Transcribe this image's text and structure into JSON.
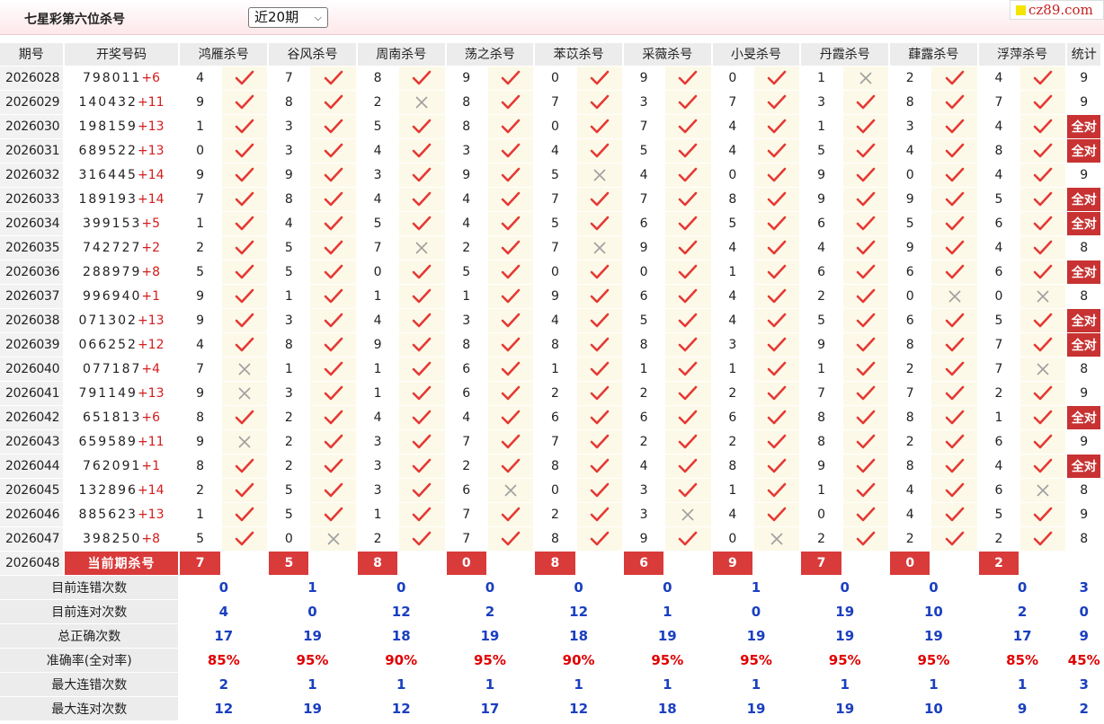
{
  "header": {
    "title": "七星彩第六位杀号",
    "period_select": "近20期",
    "logo": "cz89.com"
  },
  "columns": {
    "issue": "期号",
    "draw": "开奖号码",
    "stat": "统计",
    "experts": [
      "鸿雁杀号",
      "谷风杀号",
      "周南杀号",
      "荡之杀号",
      "苯苡杀号",
      "采薇杀号",
      "小旻杀号",
      "丹霞杀号",
      "蕼露杀号",
      "浮萍杀号"
    ]
  },
  "rows": [
    {
      "issue": "2026028",
      "main": "798011",
      "extra": "+6",
      "kills": [
        "4",
        "7",
        "8",
        "9",
        "0",
        "9",
        "0",
        "1",
        "2",
        "4"
      ],
      "marks": [
        "ok",
        "ok",
        "ok",
        "ok",
        "ok",
        "ok",
        "ok",
        "no",
        "ok",
        "ok"
      ],
      "stat": "9"
    },
    {
      "issue": "2026029",
      "main": "140432",
      "extra": "+11",
      "kills": [
        "9",
        "8",
        "2",
        "8",
        "7",
        "3",
        "7",
        "3",
        "8",
        "7"
      ],
      "marks": [
        "ok",
        "ok",
        "no",
        "ok",
        "ok",
        "ok",
        "ok",
        "ok",
        "ok",
        "ok"
      ],
      "stat": "9"
    },
    {
      "issue": "2026030",
      "main": "198159",
      "extra": "+13",
      "kills": [
        "1",
        "3",
        "5",
        "8",
        "0",
        "7",
        "4",
        "1",
        "3",
        "4"
      ],
      "marks": [
        "ok",
        "ok",
        "ok",
        "ok",
        "ok",
        "ok",
        "ok",
        "ok",
        "ok",
        "ok"
      ],
      "stat": "全对"
    },
    {
      "issue": "2026031",
      "main": "689522",
      "extra": "+13",
      "kills": [
        "0",
        "3",
        "4",
        "3",
        "4",
        "5",
        "4",
        "5",
        "4",
        "8"
      ],
      "marks": [
        "ok",
        "ok",
        "ok",
        "ok",
        "ok",
        "ok",
        "ok",
        "ok",
        "ok",
        "ok"
      ],
      "stat": "全对"
    },
    {
      "issue": "2026032",
      "main": "316445",
      "extra": "+14",
      "kills": [
        "9",
        "9",
        "3",
        "9",
        "5",
        "4",
        "0",
        "9",
        "0",
        "4"
      ],
      "marks": [
        "ok",
        "ok",
        "ok",
        "ok",
        "no",
        "ok",
        "ok",
        "ok",
        "ok",
        "ok"
      ],
      "stat": "9"
    },
    {
      "issue": "2026033",
      "main": "189193",
      "extra": "+14",
      "kills": [
        "7",
        "8",
        "4",
        "4",
        "7",
        "7",
        "8",
        "9",
        "9",
        "5"
      ],
      "marks": [
        "ok",
        "ok",
        "ok",
        "ok",
        "ok",
        "ok",
        "ok",
        "ok",
        "ok",
        "ok"
      ],
      "stat": "全对"
    },
    {
      "issue": "2026034",
      "main": "399153",
      "extra": "+5",
      "kills": [
        "1",
        "4",
        "5",
        "4",
        "5",
        "6",
        "5",
        "6",
        "5",
        "6"
      ],
      "marks": [
        "ok",
        "ok",
        "ok",
        "ok",
        "ok",
        "ok",
        "ok",
        "ok",
        "ok",
        "ok"
      ],
      "stat": "全对"
    },
    {
      "issue": "2026035",
      "main": "742727",
      "extra": "+2",
      "kills": [
        "2",
        "5",
        "7",
        "2",
        "7",
        "9",
        "4",
        "4",
        "9",
        "4"
      ],
      "marks": [
        "ok",
        "ok",
        "no",
        "ok",
        "no",
        "ok",
        "ok",
        "ok",
        "ok",
        "ok"
      ],
      "stat": "8"
    },
    {
      "issue": "2026036",
      "main": "288979",
      "extra": "+8",
      "kills": [
        "5",
        "5",
        "0",
        "5",
        "0",
        "0",
        "1",
        "6",
        "6",
        "6"
      ],
      "marks": [
        "ok",
        "ok",
        "ok",
        "ok",
        "ok",
        "ok",
        "ok",
        "ok",
        "ok",
        "ok"
      ],
      "stat": "全对"
    },
    {
      "issue": "2026037",
      "main": "996940",
      "extra": "+1",
      "kills": [
        "9",
        "1",
        "1",
        "1",
        "9",
        "6",
        "4",
        "2",
        "0",
        "0"
      ],
      "marks": [
        "ok",
        "ok",
        "ok",
        "ok",
        "ok",
        "ok",
        "ok",
        "ok",
        "no",
        "no"
      ],
      "stat": "8"
    },
    {
      "issue": "2026038",
      "main": "071302",
      "extra": "+13",
      "kills": [
        "9",
        "3",
        "4",
        "3",
        "4",
        "5",
        "4",
        "5",
        "6",
        "5"
      ],
      "marks": [
        "ok",
        "ok",
        "ok",
        "ok",
        "ok",
        "ok",
        "ok",
        "ok",
        "ok",
        "ok"
      ],
      "stat": "全对"
    },
    {
      "issue": "2026039",
      "main": "066252",
      "extra": "+12",
      "kills": [
        "4",
        "8",
        "9",
        "8",
        "8",
        "8",
        "3",
        "9",
        "8",
        "7"
      ],
      "marks": [
        "ok",
        "ok",
        "ok",
        "ok",
        "ok",
        "ok",
        "ok",
        "ok",
        "ok",
        "ok"
      ],
      "stat": "全对"
    },
    {
      "issue": "2026040",
      "main": "077187",
      "extra": "+4",
      "kills": [
        "7",
        "1",
        "1",
        "6",
        "1",
        "1",
        "1",
        "1",
        "2",
        "7"
      ],
      "marks": [
        "no",
        "ok",
        "ok",
        "ok",
        "ok",
        "ok",
        "ok",
        "ok",
        "ok",
        "no"
      ],
      "stat": "8"
    },
    {
      "issue": "2026041",
      "main": "791149",
      "extra": "+13",
      "kills": [
        "9",
        "3",
        "1",
        "6",
        "2",
        "2",
        "2",
        "7",
        "7",
        "2"
      ],
      "marks": [
        "no",
        "ok",
        "ok",
        "ok",
        "ok",
        "ok",
        "ok",
        "ok",
        "ok",
        "ok"
      ],
      "stat": "9"
    },
    {
      "issue": "2026042",
      "main": "651813",
      "extra": "+6",
      "kills": [
        "8",
        "2",
        "4",
        "4",
        "6",
        "6",
        "6",
        "8",
        "8",
        "1"
      ],
      "marks": [
        "ok",
        "ok",
        "ok",
        "ok",
        "ok",
        "ok",
        "ok",
        "ok",
        "ok",
        "ok"
      ],
      "stat": "全对"
    },
    {
      "issue": "2026043",
      "main": "659589",
      "extra": "+11",
      "kills": [
        "9",
        "2",
        "3",
        "7",
        "7",
        "2",
        "2",
        "8",
        "2",
        "6"
      ],
      "marks": [
        "no",
        "ok",
        "ok",
        "ok",
        "ok",
        "ok",
        "ok",
        "ok",
        "ok",
        "ok"
      ],
      "stat": "9"
    },
    {
      "issue": "2026044",
      "main": "762091",
      "extra": "+1",
      "kills": [
        "8",
        "2",
        "3",
        "2",
        "8",
        "4",
        "8",
        "9",
        "8",
        "4"
      ],
      "marks": [
        "ok",
        "ok",
        "ok",
        "ok",
        "ok",
        "ok",
        "ok",
        "ok",
        "ok",
        "ok"
      ],
      "stat": "全对"
    },
    {
      "issue": "2026045",
      "main": "132896",
      "extra": "+14",
      "kills": [
        "2",
        "5",
        "3",
        "6",
        "0",
        "3",
        "1",
        "1",
        "4",
        "6"
      ],
      "marks": [
        "ok",
        "ok",
        "ok",
        "no",
        "ok",
        "ok",
        "ok",
        "ok",
        "ok",
        "no"
      ],
      "stat": "8"
    },
    {
      "issue": "2026046",
      "main": "885623",
      "extra": "+13",
      "kills": [
        "1",
        "5",
        "1",
        "7",
        "2",
        "3",
        "4",
        "0",
        "4",
        "5"
      ],
      "marks": [
        "ok",
        "ok",
        "ok",
        "ok",
        "ok",
        "no",
        "ok",
        "ok",
        "ok",
        "ok"
      ],
      "stat": "9"
    },
    {
      "issue": "2026047",
      "main": "398250",
      "extra": "+8",
      "kills": [
        "5",
        "0",
        "2",
        "7",
        "8",
        "9",
        "0",
        "2",
        "2",
        "2"
      ],
      "marks": [
        "ok",
        "no",
        "ok",
        "ok",
        "ok",
        "ok",
        "no",
        "ok",
        "ok",
        "ok"
      ],
      "stat": "8"
    }
  ],
  "current": {
    "issue": "2026048",
    "label": "当前期杀号",
    "kills": [
      "7",
      "5",
      "8",
      "0",
      "8",
      "6",
      "9",
      "7",
      "0",
      "2"
    ]
  },
  "stats": [
    {
      "label": "目前连错次数",
      "values": [
        "0",
        "1",
        "0",
        "0",
        "0",
        "0",
        "1",
        "0",
        "0",
        "0"
      ],
      "total": "3",
      "red": false
    },
    {
      "label": "目前连对次数",
      "values": [
        "4",
        "0",
        "12",
        "2",
        "12",
        "1",
        "0",
        "19",
        "10",
        "2"
      ],
      "total": "0",
      "red": false
    },
    {
      "label": "总正确次数",
      "values": [
        "17",
        "19",
        "18",
        "19",
        "18",
        "19",
        "19",
        "19",
        "19",
        "17"
      ],
      "total": "9",
      "red": false
    },
    {
      "label": "准确率(全对率)",
      "values": [
        "85%",
        "95%",
        "90%",
        "95%",
        "90%",
        "95%",
        "95%",
        "95%",
        "95%",
        "85%"
      ],
      "total": "45%",
      "red": true
    },
    {
      "label": "最大连错次数",
      "values": [
        "2",
        "1",
        "1",
        "1",
        "1",
        "1",
        "1",
        "1",
        "1",
        "1"
      ],
      "total": "3",
      "red": false
    },
    {
      "label": "最大连对次数",
      "values": [
        "12",
        "19",
        "12",
        "17",
        "12",
        "18",
        "19",
        "19",
        "10",
        "9"
      ],
      "total": "2",
      "red": false
    }
  ],
  "colors": {
    "check": "#e53935",
    "cross": "#a0a0a0",
    "accent": "#d93a3a",
    "stat_blue": "#1a3fc0"
  }
}
